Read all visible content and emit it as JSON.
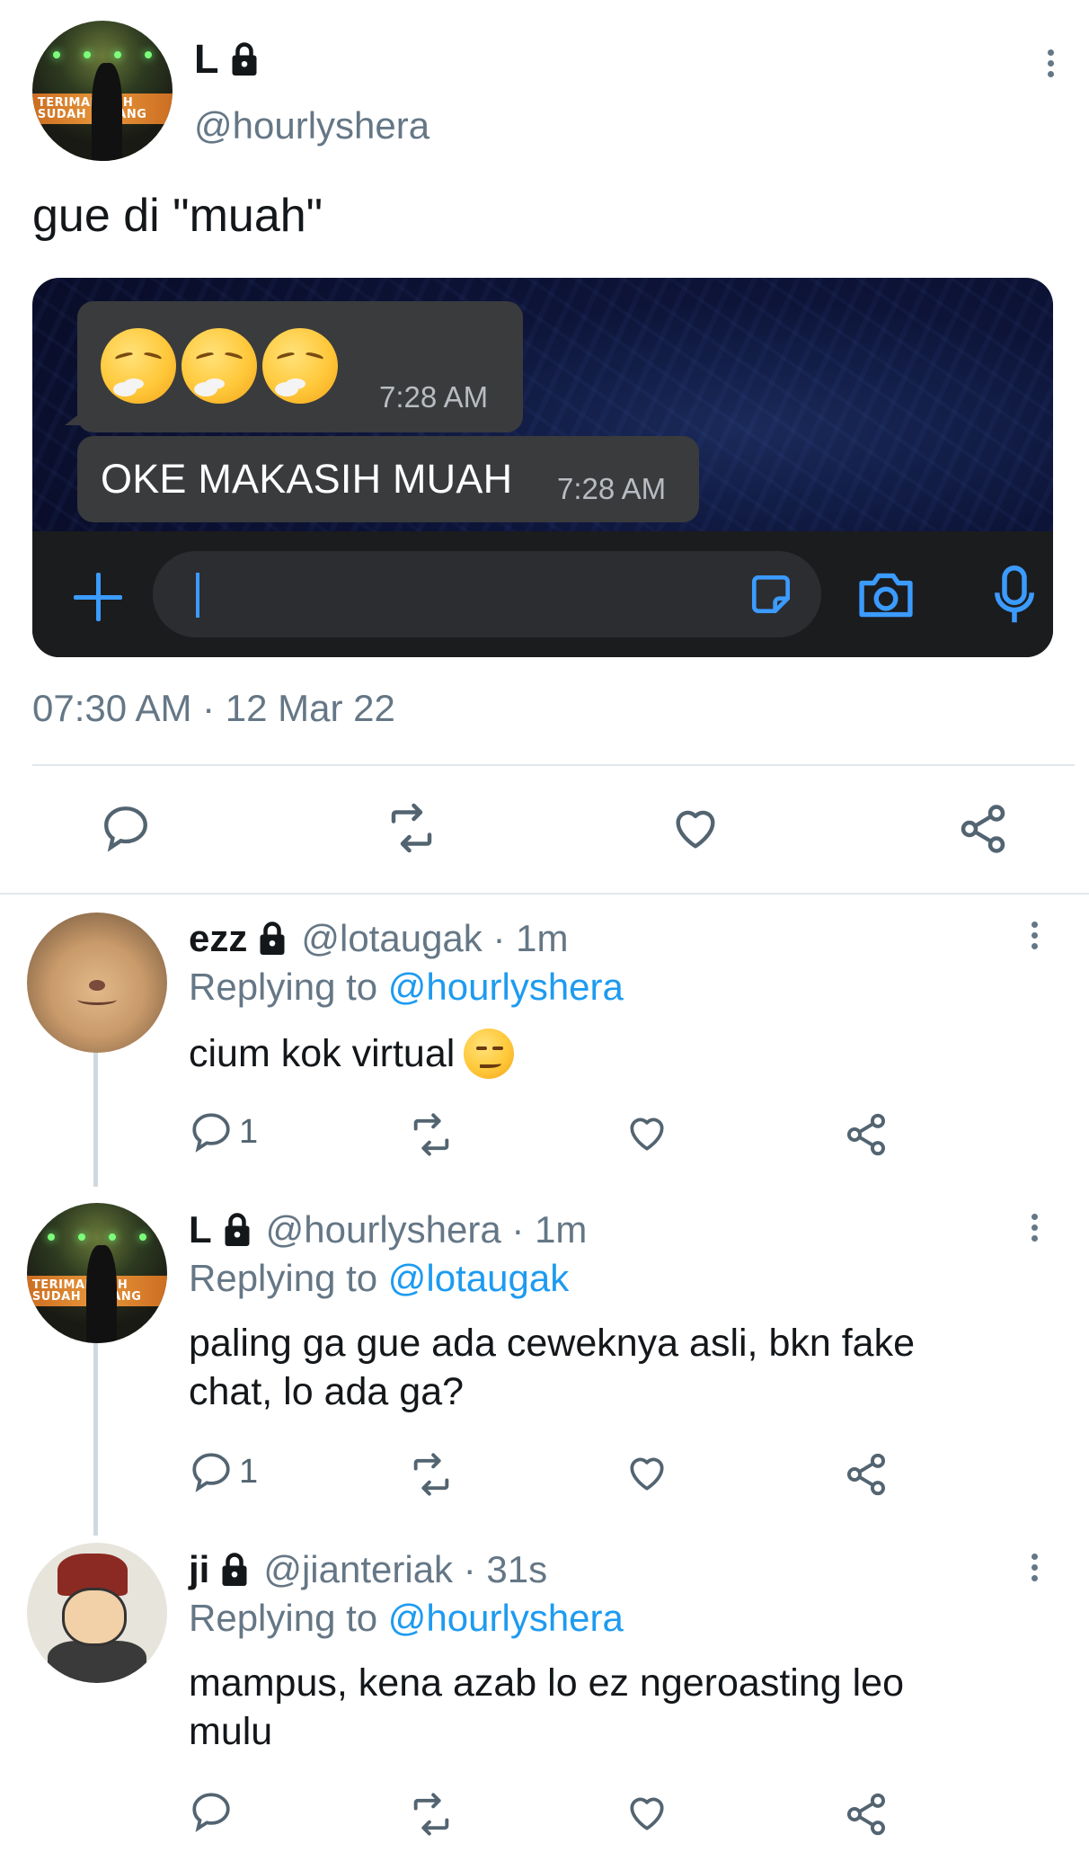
{
  "main_tweet": {
    "display_name": "L",
    "handle": "@hourlyshera",
    "text": "gue di \"muah\"",
    "timestamp": "07:30 AM · 12 Mar 22",
    "avatar_banner_text": "TERIMAKASIH\nSUDAH DATANG",
    "embedded_chat": {
      "bubble1_time": "7:28 AM",
      "bubble2_text": "OKE MAKASIH MUAH",
      "bubble2_time": "7:28 AM"
    }
  },
  "replies": [
    {
      "display_name": "ezz",
      "handle_time": "@lotaugak · 1m",
      "replying_prefix": "Replying to ",
      "replying_to": "@hourlyshera",
      "text": "cium kok virtual",
      "reply_count": "1"
    },
    {
      "display_name": "L",
      "handle_time": "@hourlyshera · 1m",
      "replying_prefix": "Replying to ",
      "replying_to": "@lotaugak",
      "text_line1": "paling ga gue ada ceweknya asli, bkn fake",
      "text_line2": "chat, lo ada ga?",
      "reply_count": "1"
    },
    {
      "display_name": "ji",
      "handle_time": "@jianteriak · 31s",
      "replying_prefix": "Replying to ",
      "replying_to": "@hourlyshera",
      "text_line1": "mampus, kena azab lo ez ngeroasting leo",
      "text_line2": "mulu",
      "reply_count": ""
    }
  ],
  "colors": {
    "link": "#1d9bf0",
    "secondary_text": "#657786",
    "primary_text": "#14171a"
  },
  "icons": [
    "lock-icon",
    "more-icon",
    "reply-icon",
    "retweet-icon",
    "like-icon",
    "share-icon",
    "plus-icon",
    "sticker-icon",
    "camera-icon",
    "mic-icon"
  ]
}
